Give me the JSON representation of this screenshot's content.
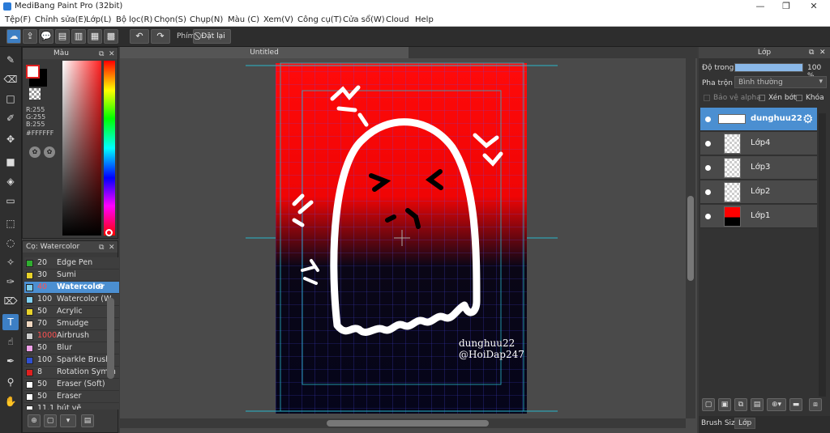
{
  "app": {
    "title": "MediBang Paint Pro (32bit)"
  },
  "window_controls": {
    "minimize": "—",
    "maximize": "❐",
    "close": "✕"
  },
  "menu": [
    "Tệp(F)",
    "Chỉnh sửa(E)",
    "Lớp(L)",
    "Bộ lọc(R)",
    "Chọn(S)",
    "Chụp(N)",
    "Màu (C)",
    "Xem(V)",
    "Công cụ(T)",
    "Cửa sổ(W)",
    "Cloud",
    "Help"
  ],
  "toolbar": {
    "shortcut_label": "Phím",
    "reset_label": "Đặt lại"
  },
  "color_panel": {
    "title": "Màu",
    "r": "R:255",
    "g": "G:255",
    "b": "B:255",
    "hex": "#FFFFFF",
    "foreground": "#ffffff",
    "background": "#000000"
  },
  "brush_panel": {
    "title": "Cọ: Watercolor",
    "items": [
      {
        "size": "20",
        "name": "Edge Pen",
        "color": "#2fae2f"
      },
      {
        "size": "30",
        "name": "Sumi",
        "color": "#e8d22a"
      },
      {
        "size": "40",
        "name": "Watercolor",
        "color": "#7fd0f0"
      },
      {
        "size": "100",
        "name": "Watercolor (W",
        "color": "#7fd0f0"
      },
      {
        "size": "50",
        "name": "Acrylic",
        "color": "#e8d22a"
      },
      {
        "size": "70",
        "name": "Smudge",
        "color": "#f0d7c0"
      },
      {
        "size": "1000",
        "name": "Airbrush",
        "color": "#cccccc"
      },
      {
        "size": "50",
        "name": "Blur",
        "color": "#f0a0e8"
      },
      {
        "size": "100",
        "name": "Sparkle Brush",
        "color": "#3050d0"
      },
      {
        "size": "8",
        "name": "Rotation Symm",
        "color": "#e02020"
      },
      {
        "size": "50",
        "name": "Eraser (Soft)",
        "color": "#ffffff"
      },
      {
        "size": "50",
        "name": "Eraser",
        "color": "#ffffff"
      },
      {
        "size": "11.1",
        "name": "bút vẽ",
        "color": "#ffffff"
      }
    ]
  },
  "document": {
    "tab": "Untitled",
    "signature_line1": "dunghuu22",
    "signature_line2": "@HoiDap247"
  },
  "layer_panel": {
    "title": "Lớp",
    "opacity_label": "Độ trong",
    "opacity_value": "100 %",
    "opacity_fraction": 1.0,
    "blend_label": "Pha trộn",
    "blend_value": "Bình thường",
    "protect_alpha": "Bảo vệ alpha",
    "clipping": "Xén bớt",
    "lock": "Khóa",
    "layers": [
      {
        "name": "dunghuu22",
        "selected": true
      },
      {
        "name": "Lớp4",
        "selected": false
      },
      {
        "name": "Lớp3",
        "selected": false
      },
      {
        "name": "Lớp2",
        "selected": false
      },
      {
        "name": "Lớp1",
        "selected": false
      }
    ],
    "bottom_tabs": [
      "Brush Size",
      "Lớp"
    ]
  },
  "colors": {
    "accent": "#4b8fd1",
    "guide": "#29b6c9",
    "canvas_red": "#ff0a0a",
    "canvas_dark": "#05051a"
  }
}
